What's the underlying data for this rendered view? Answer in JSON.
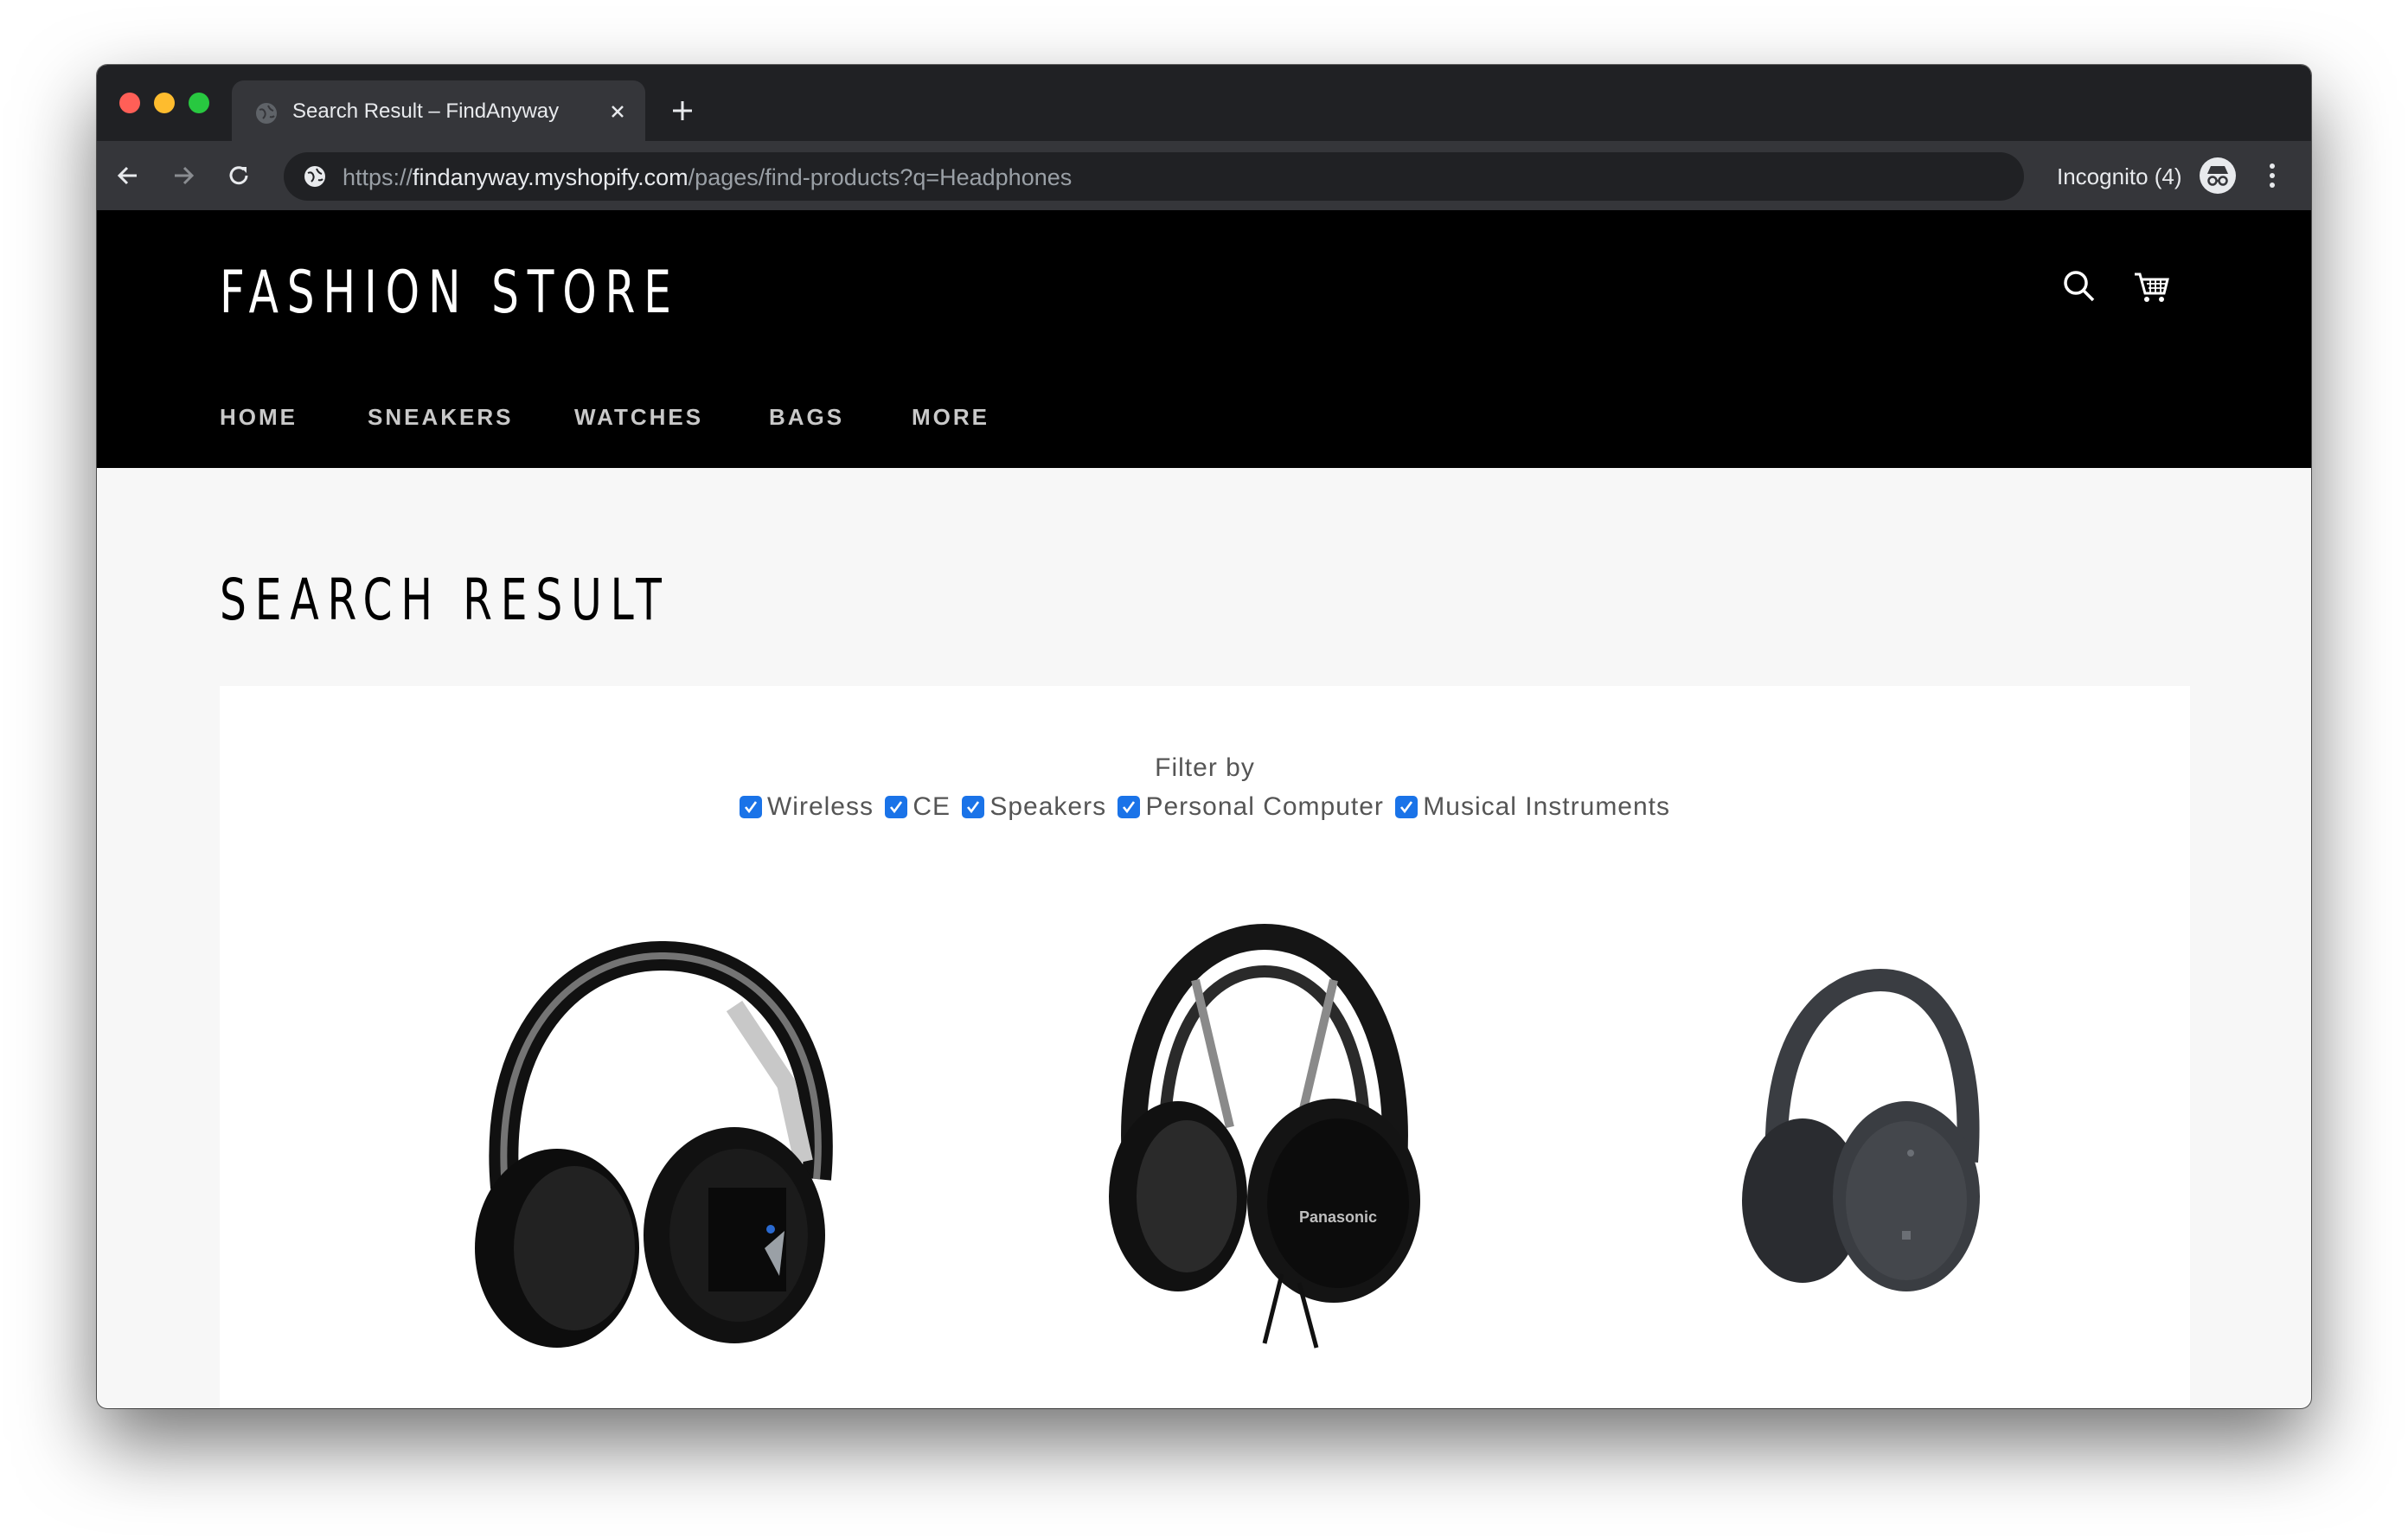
{
  "browser": {
    "tab_title": "Search Result – FindAnyway",
    "url_scheme": "https://",
    "url_host": "findanyway.myshopify.com",
    "url_path": "/pages/find-products?q=Headphones",
    "incognito_label": "Incognito (4)"
  },
  "store": {
    "logo": "FASHION STORE",
    "nav": [
      "HOME",
      "SNEAKERS",
      "WATCHES",
      "BAGS",
      "MORE"
    ]
  },
  "page": {
    "title": "SEARCH RESULT",
    "filter_label": "Filter by",
    "filters": [
      {
        "label": "Wireless",
        "checked": true
      },
      {
        "label": "CE",
        "checked": true
      },
      {
        "label": "Speakers",
        "checked": true
      },
      {
        "label": "Personal Computer",
        "checked": true
      },
      {
        "label": "Musical Instruments",
        "checked": true
      }
    ]
  },
  "products": [
    {
      "image": "black-silver-over-ear-headphones",
      "color": "#111111",
      "accent": "#b8b8b8"
    },
    {
      "image": "black-open-headphones-panasonic",
      "color": "#151515",
      "accent": "#8a8a8a",
      "brand_mark": "Panasonic"
    },
    {
      "image": "dark-gray-noise-cancelling-headphones",
      "color": "#3a3d42",
      "accent": "#2a2c30"
    }
  ],
  "colors": {
    "store_header_bg": "#000000",
    "page_bg": "#f7f7f7",
    "checkbox": "#1a73e8",
    "chrome_dark": "#202124",
    "chrome_toolbar": "#35363a"
  }
}
